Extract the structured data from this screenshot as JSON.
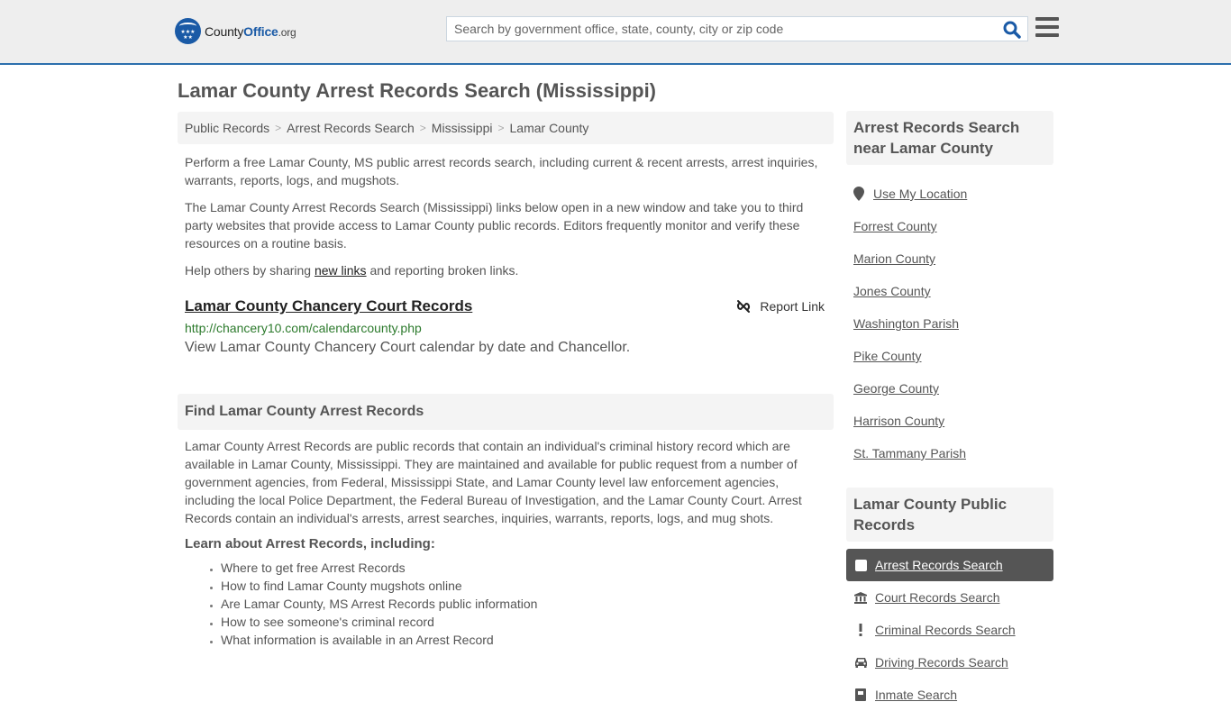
{
  "header": {
    "logo": {
      "county": "County",
      "office": "Office",
      "org": ".org"
    },
    "search": {
      "placeholder": "Search by government office, state, county, city or zip code",
      "value": ""
    },
    "colors": {
      "brand": "#1a5aa6",
      "accent_border": "#2c6fad"
    }
  },
  "page_title": "Lamar County Arrest Records Search (Mississippi)",
  "breadcrumb": [
    "Public Records",
    "Arrest Records Search",
    "Mississippi",
    "Lamar County"
  ],
  "intro": {
    "p1": "Perform a free Lamar County, MS public arrest records search, including current & recent arrests, arrest inquiries, warrants, reports, logs, and mugshots.",
    "p2": "The Lamar County Arrest Records Search (Mississippi) links below open in a new window and take you to third party websites that provide access to Lamar County public records. Editors frequently monitor and verify these resources on a routine basis.",
    "p3_before": "Help others by sharing ",
    "p3_link": "new links",
    "p3_after": " and reporting broken links."
  },
  "links": [
    {
      "title": "Lamar County Chancery Court Records",
      "url": "http://chancery10.com/calendarcounty.php",
      "description": "View Lamar County Chancery Court calendar by date and Chancellor.",
      "report_label": "Report Link"
    }
  ],
  "find_section": {
    "heading": "Find Lamar County Arrest Records",
    "body": "Lamar County Arrest Records are public records that contain an individual's criminal history record which are available in Lamar County, Mississippi. They are maintained and available for public request from a number of government agencies, from Federal, Mississippi State, and Lamar County level law enforcement agencies, including the local Police Department, the Federal Bureau of Investigation, and the Lamar County Court. Arrest Records contain an individual's arrests, arrest searches, inquiries, warrants, reports, logs, and mug shots.",
    "learn_title": "Learn about Arrest Records, including:",
    "learn_items": [
      "Where to get free Arrest Records",
      "How to find Lamar County mugshots online",
      "Are Lamar County, MS Arrest Records public information",
      "How to see someone's criminal record",
      "What information is available in an Arrest Record"
    ]
  },
  "sidebar": {
    "near_heading": "Arrest Records Search near Lamar County",
    "use_location": "Use My Location",
    "near_items": [
      "Forrest County",
      "Marion County",
      "Jones County",
      "Washington Parish",
      "Pike County",
      "George County",
      "Harrison County",
      "St. Tammany Parish"
    ],
    "public_records_heading": "Lamar County Public Records",
    "public_records_items": [
      {
        "label": "Arrest Records Search",
        "icon": "square-icon",
        "active": true
      },
      {
        "label": "Court Records Search",
        "icon": "courthouse-icon",
        "active": false
      },
      {
        "label": "Criminal Records Search",
        "icon": "exclamation-icon",
        "active": false
      },
      {
        "label": "Driving Records Search",
        "icon": "car-icon",
        "active": false
      },
      {
        "label": "Inmate Search",
        "icon": "inmate-icon",
        "active": false
      }
    ]
  }
}
